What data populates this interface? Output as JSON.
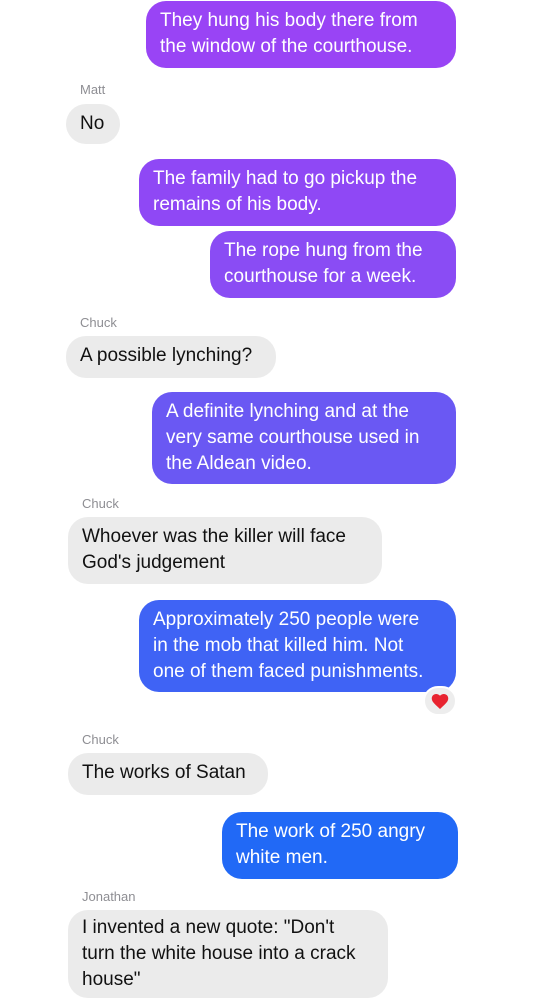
{
  "conversation": {
    "messages": [
      {
        "type": "sent",
        "text": "They hung his body there from\nthe window of the courthouse."
      },
      {
        "type": "sender",
        "text": "Matt"
      },
      {
        "type": "received",
        "text": "No"
      },
      {
        "type": "sent",
        "text": "The family had to go pickup the\nremains of his body."
      },
      {
        "type": "sent",
        "text": "The rope hung from the\ncourthouse for a week."
      },
      {
        "type": "sender",
        "text": "Chuck"
      },
      {
        "type": "received",
        "text": "A possible lynching?"
      },
      {
        "type": "sent",
        "text": "A definite lynching and at the\nvery same courthouse used in\nthe Aldean video."
      },
      {
        "type": "sender",
        "text": "Chuck"
      },
      {
        "type": "received",
        "text": "Whoever was the killer will face\nGod's judgement"
      },
      {
        "type": "sent",
        "text": "Approximately 250 people were\nin the mob that killed him. Not\none of them faced punishments.",
        "reaction": "heart-icon"
      },
      {
        "type": "sender",
        "text": "Chuck"
      },
      {
        "type": "received",
        "text": "The works of Satan"
      },
      {
        "type": "sent",
        "text": "The work of 250 angry\nwhite men."
      },
      {
        "type": "sender",
        "text": "Jonathan"
      },
      {
        "type": "received",
        "text": "I invented a new quote: \"Don't\nturn the white house into a crack\nhouse\""
      }
    ]
  },
  "colors": {
    "sent_gradient_top": "#9a43f5",
    "sent_gradient_bottom": "#1f6cf6",
    "received_bg": "#ebebeb",
    "reaction_heart": "#e8232f"
  }
}
